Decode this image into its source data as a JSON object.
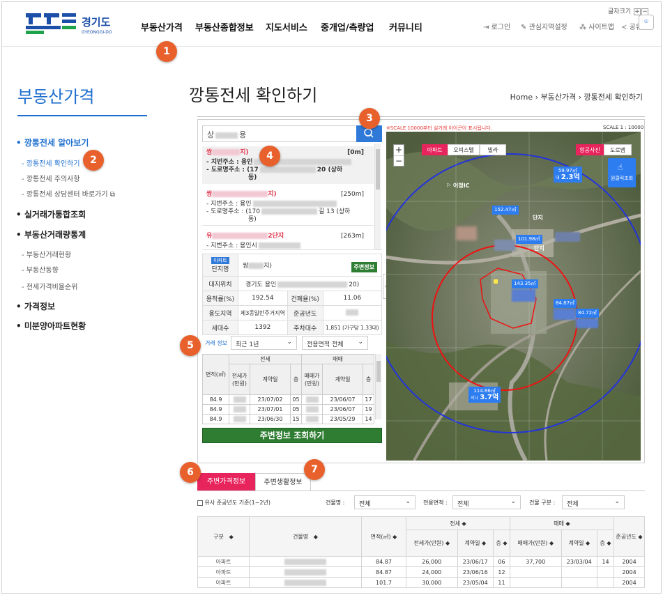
{
  "header": {
    "logo_text": "경기도",
    "logo_sub": "GYEONGGI-DO",
    "nav": [
      "부동산가격",
      "부동산종합정보",
      "지도서비스",
      "중개업/측량업",
      "커뮤니티"
    ],
    "util": [
      "로그인",
      "관심지역설정",
      "사이트맵",
      "공유"
    ],
    "font_size_label": "글자크기"
  },
  "badges": [
    "1",
    "2",
    "3",
    "4",
    "5",
    "6",
    "7"
  ],
  "sidebar": {
    "title": "부동산가격",
    "items": [
      {
        "label": "깡통전세 알아보기",
        "active": true
      },
      {
        "label": "실거래가통합조회"
      },
      {
        "label": "부동산거래량통계"
      },
      {
        "label": "가격정보"
      },
      {
        "label": "미분양아파트현황"
      }
    ],
    "sub1": [
      "깡통전세 확인하기",
      "깡통전세 주의사항",
      "깡통전세 상담센터 바로가기"
    ],
    "sub3": [
      "부동산거래현황",
      "부동산동향",
      "전세가격비율순위"
    ]
  },
  "page": {
    "title": "깡통전세 확인하기",
    "breadcrumb": [
      "Home",
      "부동산가격",
      "깡통전세 확인하기"
    ]
  },
  "search": {
    "value": "상",
    "value_tail": "용"
  },
  "results": [
    {
      "name": "쌍",
      "name_tail": "지)",
      "dist": "[0m]",
      "lot_label": "- 지번주소 :",
      "lot": "용인",
      "road_label": "- 도로명주소 :",
      "road": "(17",
      "road_tail": "20 (상하",
      "extra": "동)"
    },
    {
      "name": "쌍",
      "name_tail": "지)",
      "dist": "[250m]",
      "lot_label": "- 지번주소 :",
      "lot": "용인",
      "road_label": "- 도로명주소 :",
      "road": "(170",
      "road_tail": "길 13 (상하",
      "extra": "동)"
    },
    {
      "name": "유",
      "name_tail": "2단지",
      "dist": "[263m]",
      "lot_label": "- 지번주소 :",
      "lot": "용인시",
      "road_label": "",
      "road": "",
      "road_tail": "",
      "extra": ""
    }
  ],
  "info": {
    "type_badge": "아파트",
    "name_label": "단지명",
    "name": "쌍",
    "name_tail": "지)",
    "btn": "주변정보",
    "rows": [
      {
        "h": "대지위치",
        "v": "경기도 용인",
        "v2": "20)"
      },
      {
        "h1": "용적률(%)",
        "v1": "192.54",
        "h2": "건폐율(%)",
        "v2": "11.06"
      },
      {
        "h1": "용도지역",
        "v1": "제3종일반주거지역",
        "h2": "준공년도",
        "v2": ""
      },
      {
        "h1": "세대수",
        "v1": "1392",
        "h2": "주차대수",
        "v2": "1,851 (가구당 1.33대)"
      }
    ]
  },
  "filters": {
    "label": "거래 정보",
    "period": "최근 1년",
    "area": "전용면적 전체",
    "chevron": "⌄"
  },
  "trade": {
    "header_top": [
      "면적(㎡)",
      "전세",
      "매매"
    ],
    "header_sub": [
      "전세가(만원)",
      "계약일",
      "층",
      "매매가(만원)",
      "계약일",
      "층"
    ],
    "rows": [
      [
        "84.9",
        "23/07/02",
        "05",
        "23/06/07",
        "17"
      ],
      [
        "84.9",
        "23/07/01",
        "05",
        "23/06/07",
        "19"
      ],
      [
        "84.9",
        "23/06/30",
        "15",
        "23/05/29",
        "14"
      ]
    ]
  },
  "cta": "주변정보 조회하기",
  "map": {
    "notice": "※SCALE 10000부터 실거래 아이콘이 표시됩니다.",
    "scale": "SCALE 1 : 10000",
    "tabs_left": [
      "아파트",
      "오피스텔",
      "빌라"
    ],
    "tabs_right": [
      "항공사진",
      "도로맵"
    ],
    "zoom": [
      "+",
      "−"
    ],
    "click_label": "원클릭조회",
    "place": "어정IC",
    "markers": [
      {
        "area": "59.97㎡",
        "pre": "대",
        "price": "2.3억"
      },
      {
        "area": "152.47㎡",
        "pre": "",
        "price": ""
      },
      {
        "area": "101.98㎡",
        "pre": "",
        "price": ""
      },
      {
        "area": "143.35㎡",
        "pre": "",
        "price": ""
      },
      {
        "area": "84.87㎡",
        "pre": "",
        "price": ""
      },
      {
        "area": "84.72㎡",
        "pre": "",
        "price": ""
      },
      {
        "area": "114.86㎡",
        "pre": "서나",
        "price": "3.7억"
      }
    ],
    "label_danji": "단지",
    "label_danji2": "단지"
  },
  "bottom": {
    "tabs": [
      "주변가격정보",
      "주변생활정보"
    ],
    "checkbox": "유사 준공년도 기준(1~2년)",
    "f1_label": "건물명 :",
    "f1": "전체",
    "f2_label": "전용면적 :",
    "f2": "전체",
    "f3_label": "건물 구분 :",
    "f3": "전체",
    "table": {
      "headers": [
        "구분",
        "건물명",
        "면적(㎡)",
        "전세",
        "매매",
        "준공년도"
      ],
      "sub": [
        "전세가(만원)",
        "계약일",
        "층",
        "매매가(만원)",
        "계약일",
        "층"
      ],
      "sort": "◆",
      "rows": [
        [
          "아파트",
          "84.87",
          "26,000",
          "23/06/17",
          "06",
          "37,700",
          "23/03/04",
          "14",
          "2004"
        ],
        [
          "아파트",
          "84.87",
          "24,000",
          "23/06/16",
          "12",
          "",
          "",
          "",
          "2004"
        ],
        [
          "아파트",
          "101.7",
          "30,000",
          "23/05/04",
          "11",
          "",
          "",
          "",
          "2004"
        ]
      ]
    }
  }
}
